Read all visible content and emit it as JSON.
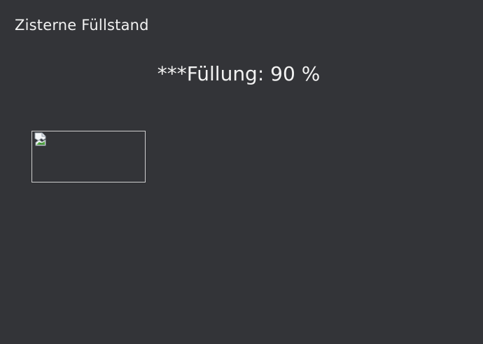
{
  "header": {
    "title": "Zisterne Füllstand"
  },
  "status": {
    "fill_label": "***Füllung: 90 %"
  },
  "image": {
    "icon": "broken-image-icon"
  }
}
